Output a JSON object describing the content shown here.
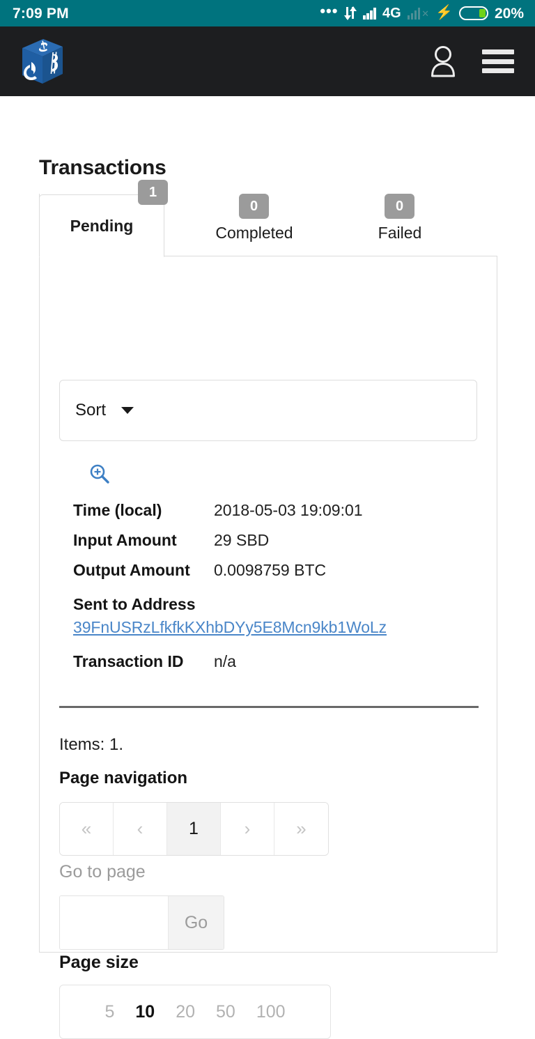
{
  "status_bar": {
    "time": "7:09 PM",
    "more_icon": "more-horizontal-icon",
    "data_transfer_icon": "data-transfer-icon",
    "signal_icon": "signal-bars-icon",
    "network_type": "4G",
    "sim2_icon": "no-sim-signal-icon",
    "charging_icon": "charging-bolt-icon",
    "battery_icon": "battery-icon",
    "battery_percent": "20%",
    "bg_color": "#00737e"
  },
  "app_header": {
    "logo_name": "bitshares-cube-logo",
    "account_icon": "user-account-icon",
    "menu_icon": "hamburger-menu-icon",
    "bg_color": "#1d1e20"
  },
  "page": {
    "title": "Transactions"
  },
  "tabs": [
    {
      "label": "Pending",
      "badge": "1",
      "active": true
    },
    {
      "label": "Completed",
      "badge": "0",
      "active": false
    },
    {
      "label": "Failed",
      "badge": "0",
      "active": false
    }
  ],
  "sort": {
    "label": "Sort",
    "caret_icon": "chevron-down-icon"
  },
  "transaction": {
    "zoom_icon": "zoom-in-icon",
    "rows": [
      {
        "label": "Time (local)",
        "value": "2018-05-03 19:09:01"
      },
      {
        "label": "Input Amount",
        "value": "29 SBD"
      },
      {
        "label": "Output Amount",
        "value": "0.0098759 BTC"
      }
    ],
    "address_label": "Sent to Address",
    "address_value": "39FnUSRzLfkfkKXhbDYy5E8Mcn9kb1WoLz",
    "address_color": "#4a86c8",
    "txid_label": "Transaction ID",
    "txid_value": "n/a"
  },
  "pagination": {
    "items_text": "Items: 1.",
    "nav_title": "Page navigation",
    "buttons": [
      {
        "label": "«",
        "name": "first-page-button",
        "current": false
      },
      {
        "label": "‹",
        "name": "previous-page-button",
        "current": false
      },
      {
        "label": "1",
        "name": "page-1-button",
        "current": true
      },
      {
        "label": "›",
        "name": "next-page-button",
        "current": false
      },
      {
        "label": "»",
        "name": "last-page-button",
        "current": false
      }
    ],
    "goto_label": "Go to page",
    "goto_value": "",
    "goto_placeholder": "",
    "go_button": "Go",
    "page_size_title": "Page size",
    "page_size_options": [
      {
        "label": "5",
        "selected": false
      },
      {
        "label": "10",
        "selected": true
      },
      {
        "label": "20",
        "selected": false
      },
      {
        "label": "50",
        "selected": false
      },
      {
        "label": "100",
        "selected": false
      }
    ]
  }
}
